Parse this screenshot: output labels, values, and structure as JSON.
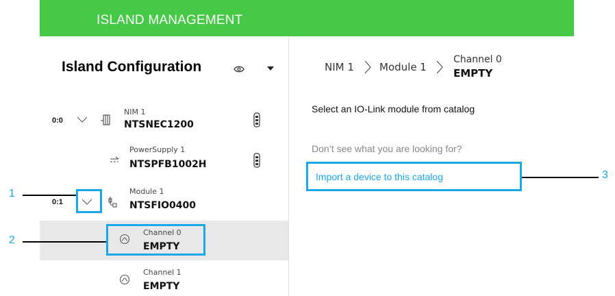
{
  "header": {
    "title": "ISLAND MANAGEMENT"
  },
  "panel": {
    "title": "Island Configuration",
    "view_icon": "eye-icon",
    "menu_icon": "caret-down-icon"
  },
  "tree": {
    "nim": {
      "index": "0:0",
      "type": "NIM 1",
      "name": "NTSNEC1200",
      "icon": "nim-rack-icon"
    },
    "power": {
      "type": "PowerSupply 1",
      "name": "NTSPFB1002H",
      "icon": "power-supply-icon"
    },
    "module": {
      "index": "0:1",
      "type": "Module 1",
      "name": "NTSFIO0400",
      "icon": "module-icon"
    },
    "channel0": {
      "type": "Channel 0",
      "name": "EMPTY",
      "icon": "channel-icon"
    },
    "channel1": {
      "type": "Channel 1",
      "name": "EMPTY",
      "icon": "channel-icon"
    }
  },
  "breadcrumb": {
    "item1": "NIM 1",
    "item2": "Module 1",
    "item3_sub": "Channel 0",
    "item3_main": "EMPTY"
  },
  "content": {
    "instruction": "Select an IO-Link module from catalog",
    "question": "Don’t see what you are looking for?",
    "import_link": "Import a device to this catalog"
  },
  "callouts": {
    "one": "1",
    "two": "2",
    "three": "3"
  },
  "colors": {
    "header_green": "#46c946",
    "callout_blue": "#1aa7e8",
    "selected_row": "#e8e8e8"
  }
}
